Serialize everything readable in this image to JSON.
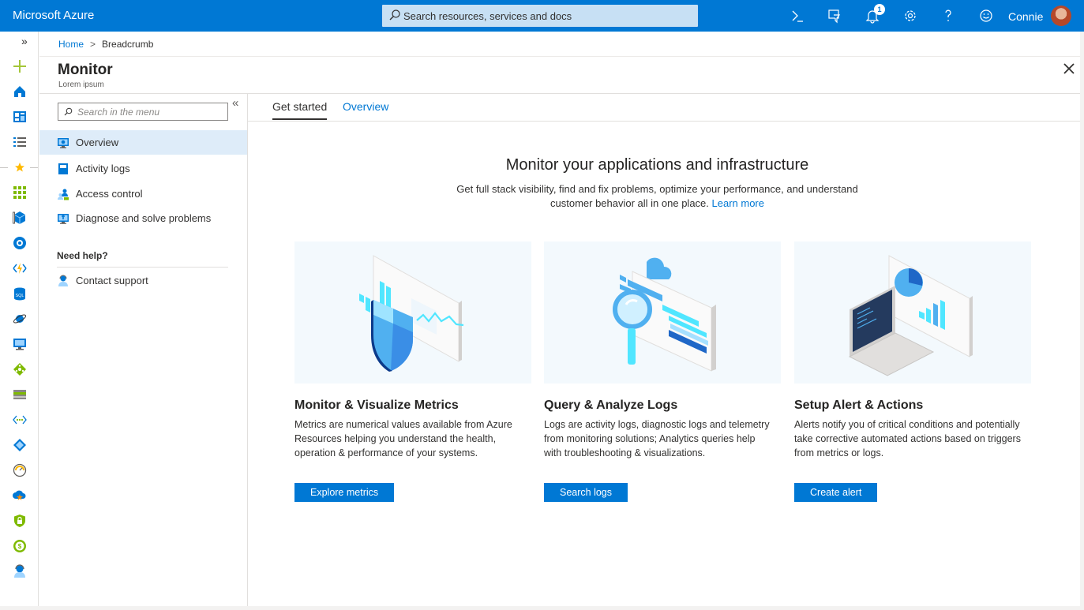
{
  "header": {
    "brand": "Microsoft Azure",
    "search_placeholder": "Search resources, services and docs",
    "notification_count": "1",
    "user_name": "Connie",
    "icons": [
      "cloud-shell-icon",
      "directory-filter-icon",
      "notification-bell-icon",
      "settings-gear-icon",
      "help-question-icon",
      "feedback-smiley-icon"
    ]
  },
  "rail": {
    "expand_glyph": "»",
    "icons": [
      "create-resource-icon",
      "home-icon",
      "dashboard-icon",
      "all-services-icon",
      "favorites-star-icon",
      "all-resources-icon",
      "resource-groups-icon",
      "app-services-icon",
      "function-app-icon",
      "sql-database-icon",
      "cosmos-db-icon",
      "virtual-machine-icon",
      "load-balancer-icon",
      "storage-account-icon",
      "virtual-network-icon",
      "azure-ad-icon",
      "monitor-icon",
      "advisor-icon",
      "security-center-icon",
      "cost-management-icon",
      "help-support-icon"
    ]
  },
  "breadcrumb": {
    "home": "Home",
    "separator": ">",
    "current": "Breadcrumb"
  },
  "page": {
    "title": "Monitor",
    "subtitle": "Lorem ipsum"
  },
  "menu": {
    "search_placeholder": "Search in the menu",
    "collapse_glyph": "«",
    "items": [
      {
        "label": "Overview",
        "icon": "monitor-overview-icon",
        "active": true
      },
      {
        "label": "Activity logs",
        "icon": "activity-log-icon",
        "active": false
      },
      {
        "label": "Access control",
        "icon": "access-control-icon",
        "active": false
      },
      {
        "label": "Diagnose and solve problems",
        "icon": "diagnose-icon",
        "active": false
      }
    ],
    "help_title": "Need help?",
    "help_items": [
      {
        "label": "Contact support",
        "icon": "support-icon"
      }
    ]
  },
  "tabs": [
    {
      "label": "Get started",
      "active": true
    },
    {
      "label": "Overview",
      "active": false
    }
  ],
  "hero": {
    "title": "Monitor your applications and infrastructure",
    "description": "Get full stack visibility, find and fix problems, optimize your performance, and understand customer behavior all in one place.",
    "learn_more": "Learn more"
  },
  "cards": [
    {
      "title": "Monitor & Visualize Metrics",
      "text": "Metrics are numerical values available from Azure Resources helping you understand the health, operation & performance of your systems.",
      "button": "Explore metrics",
      "illustration": "metrics-shield-illustration"
    },
    {
      "title": "Query & Analyze Logs",
      "text": "Logs are activity logs, diagnostic logs and telemetry from monitoring solutions; Analytics queries help with troubleshooting & visualizations.",
      "button": "Search logs",
      "illustration": "logs-magnifier-illustration"
    },
    {
      "title": "Setup Alert & Actions",
      "text": "Alerts notify you of critical conditions and potentially take corrective automated actions based on triggers from metrics or logs.",
      "button": "Create alert",
      "illustration": "alerts-laptop-illustration"
    }
  ],
  "colors": {
    "accent": "#0078d4",
    "selected": "#deecf9",
    "search_box": "#c7e0f4"
  }
}
